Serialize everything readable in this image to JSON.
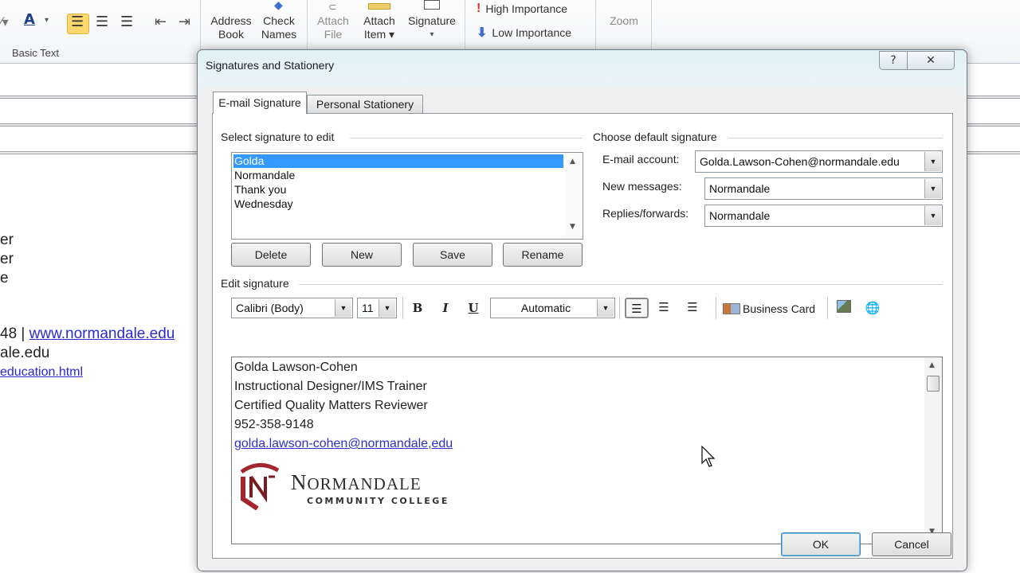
{
  "ribbon": {
    "basic_text_label": "Basic Text",
    "address_book": [
      "Address",
      "Book"
    ],
    "check_names": [
      "Check",
      "Names"
    ],
    "attach_file": [
      "Attach",
      "File"
    ],
    "attach_item": [
      "Attach",
      "Item ▾"
    ],
    "signature": [
      "Signature",
      "▾"
    ],
    "high_importance": "High Importance",
    "low_importance": "Low Importance",
    "zoom": "Zoom"
  },
  "background_body": {
    "lines": [
      "er",
      "er",
      "e"
    ],
    "phone_fragment": "48 | ",
    "website_link": "www.normandale.edu",
    "email_fragment": "ale.edu",
    "page_link": "education.html"
  },
  "dialog": {
    "title": "Signatures and Stationery",
    "help_icon": "?",
    "close_icon": "✕",
    "tabs": [
      {
        "label": "E-mail Signature",
        "active": true
      },
      {
        "label": "Personal Stationery",
        "active": false
      }
    ],
    "select_section_label": "Select signature to edit",
    "signatures": [
      {
        "name": "Golda",
        "selected": true
      },
      {
        "name": "Normandale",
        "selected": false
      },
      {
        "name": "Thank you",
        "selected": false
      },
      {
        "name": "Wednesday",
        "selected": false
      }
    ],
    "buttons": {
      "delete": "Delete",
      "new": "New",
      "save": "Save",
      "rename": "Rename",
      "ok": "OK",
      "cancel": "Cancel"
    },
    "default_section_label": "Choose default signature",
    "email_account_label": "E-mail account:",
    "email_account_value": "Golda.Lawson-Cohen@normandale.edu",
    "new_messages_label": "New messages:",
    "new_messages_value": "Normandale",
    "replies_label": "Replies/forwards:",
    "replies_value": "Normandale",
    "edit_section_label": "Edit signature",
    "toolbar": {
      "font": "Calibri (Body)",
      "size": "11",
      "bold": "B",
      "italic": "I",
      "underline": "U",
      "color": "Automatic",
      "business_card": "Business Card"
    },
    "signature_content": {
      "name": "Golda Lawson-Cohen",
      "title": "Instructional Designer/IMS Trainer",
      "certification": "Certified Quality Matters Reviewer",
      "phone": "952-358-9148",
      "email": "golda.lawson-cohen@normandale,edu",
      "logo_word_first": "N",
      "logo_word_rest": "ORMANDALE",
      "logo_subtitle": "COMMUNITY COLLEGE"
    }
  },
  "colors": {
    "selection": "#3399ff",
    "link": "#2c32c9",
    "logo_red": "#a3262d",
    "active_align": "#fbd96e"
  }
}
